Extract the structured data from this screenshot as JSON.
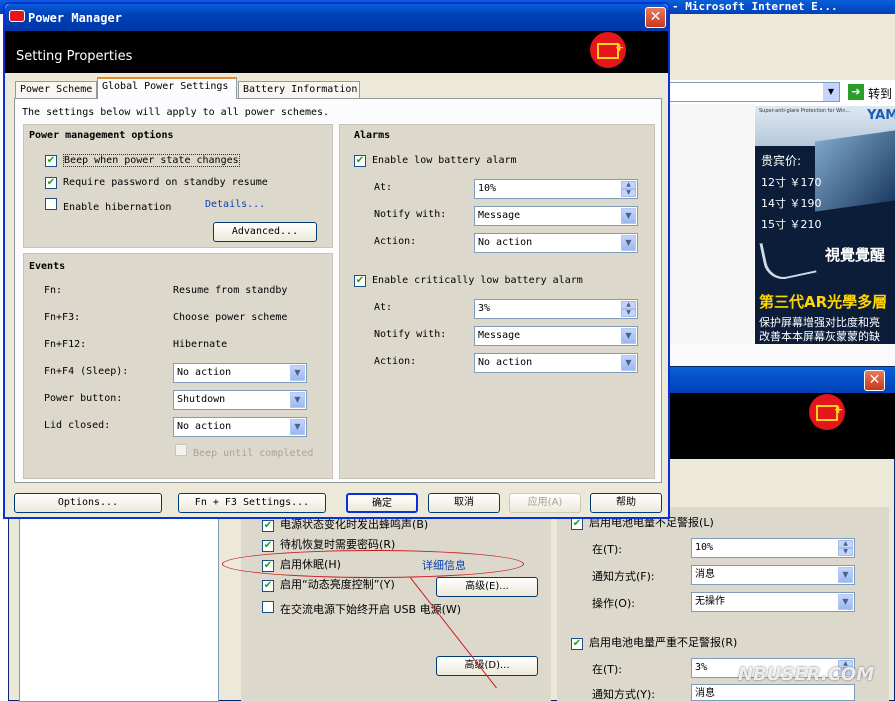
{
  "bg_browser": {
    "title_fragment": "- Microsoft Internet E...",
    "go_label": "转到",
    "ad_brand": "YAM",
    "ad_tagline": "Super-anti-glare Protection for Win...",
    "ad_price_title": "贵宾价:",
    "ad_prices": [
      "12寸 ￥170",
      "14寸 ￥190",
      "15寸 ￥210"
    ],
    "ad_logo_text": "視覺覺醒",
    "ad_product": "第三代AR光學多層",
    "ad_desc1": "保护屏幕增强对比度和亮",
    "ad_desc2": "改善本本屏幕灰蒙蒙的缺"
  },
  "bg_dialog": {
    "rows": [
      {
        "label": "电源状态变化时发出蜂鸣声(B)",
        "checked": true
      },
      {
        "label": "待机恢复时需要密码(R)",
        "checked": true
      },
      {
        "label": "启用休眠(H)",
        "checked": true
      },
      {
        "label": "启用“动态亮度控制”(Y)",
        "checked": true
      },
      {
        "label": "在交流电源下始终开启 USB 电源(W)",
        "checked": false
      }
    ],
    "details_link": "详细信息",
    "advanced_btn": "高级(E)...",
    "advanced_btn2": "高级(D)...",
    "alarm1_label": "启用电池电量不足警报(L)",
    "alarm2_label": "启用电池电量严重不足警报(R)",
    "at_label": "在(T):",
    "at2_label": "在(T):",
    "at_value": "10%",
    "at2_value": "3%",
    "notify_label": "通知方式(F):",
    "notify2_label": "通知方式(Y):",
    "notify_value": "消息",
    "notify2_value": "消息",
    "action_label": "操作(O):",
    "action_value": "无操作",
    "watermark": "NBUSER.COM"
  },
  "window": {
    "title": "Power Manager",
    "header": "Setting Properties",
    "tabs": [
      "Power Scheme",
      "Global Power Settings",
      "Battery Information"
    ],
    "active_tab": 1,
    "intro": "The settings below will apply to all power schemes.",
    "pm_options": {
      "title": "Power management options",
      "beep": "Beep when power state changes",
      "password": "Require password on standby resume",
      "hibernation": "Enable hibernation",
      "details": "Details...",
      "advanced": "Advanced..."
    },
    "events": {
      "title": "Events",
      "rows": [
        {
          "key": "Fn:",
          "value": "Resume from standby"
        },
        {
          "key": "Fn+F3:",
          "value": "Choose power scheme"
        },
        {
          "key": "Fn+F12:",
          "value": "Hibernate"
        }
      ],
      "sleep_label": "Fn+F4 (Sleep):",
      "sleep_value": "No action",
      "power_label": "Power button:",
      "power_value": "Shutdown",
      "lid_label": "Lid closed:",
      "lid_value": "No action",
      "beep_until": "Beep until completed"
    },
    "alarms": {
      "title": "Alarms",
      "low_label": "Enable low battery alarm",
      "crit_label": "Enable critically low battery alarm",
      "at_label": "At:",
      "notify_label": "Notify with:",
      "action_label": "Action:",
      "low_at": "10%",
      "low_notify": "Message",
      "low_action": "No action",
      "crit_at": "3%",
      "crit_notify": "Message",
      "crit_action": "No action"
    },
    "buttons": {
      "options": "Options...",
      "fnf3": "Fn + F3 Settings...",
      "ok": "确定",
      "cancel": "取消",
      "apply": "应用(A)",
      "help": "帮助"
    }
  }
}
